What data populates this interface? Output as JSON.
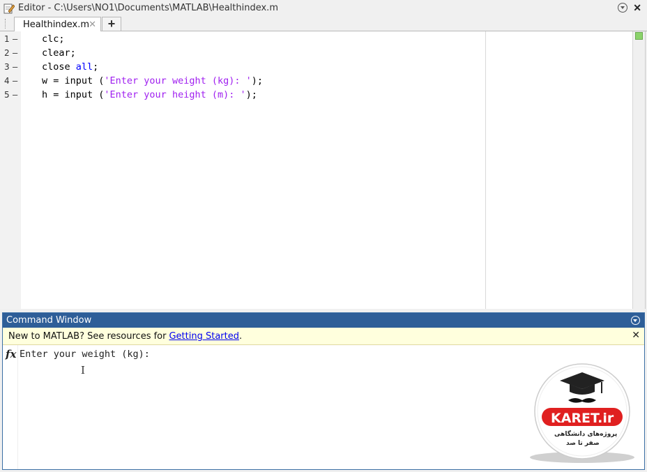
{
  "editor": {
    "title": "Editor - C:\\Users\\NO1\\Documents\\MATLAB\\Healthindex.m",
    "tab_label": "Healthindex.m",
    "tab_close": "✕",
    "tab_add": "+",
    "lines": [
      {
        "num": "1",
        "dash": "–"
      },
      {
        "num": "2",
        "dash": "–"
      },
      {
        "num": "3",
        "dash": "–"
      },
      {
        "num": "4",
        "dash": "–"
      },
      {
        "num": "5",
        "dash": "–"
      }
    ],
    "code": {
      "l1": "clc;",
      "l2": "clear;",
      "l3_a": "close ",
      "l3_kw": "all",
      "l3_b": ";",
      "l4_a": "w = input (",
      "l4_str": "'Enter your weight (kg): '",
      "l4_b": ");",
      "l5_a": "h = input (",
      "l5_str": "'Enter your height (m): '",
      "l5_b": ");"
    }
  },
  "command_window": {
    "title": "Command Window",
    "notice_text": "New to MATLAB? See resources for",
    "notice_link": "Getting Started",
    "notice_end": ".",
    "fx_label": "fx",
    "prompt_output": "Enter your weight (kg):",
    "close_label": "✕"
  },
  "logo": {
    "brand": "KARET.ir",
    "tagline_1": "پروژه‌های دانشگاهی",
    "tagline_2": "صفر تا صد"
  },
  "colors": {
    "keyword": "#0000ff",
    "string": "#a020f0",
    "cw_title_bg": "#2e5e98",
    "notice_bg": "#ffffdd",
    "logo_red": "#e02020"
  }
}
